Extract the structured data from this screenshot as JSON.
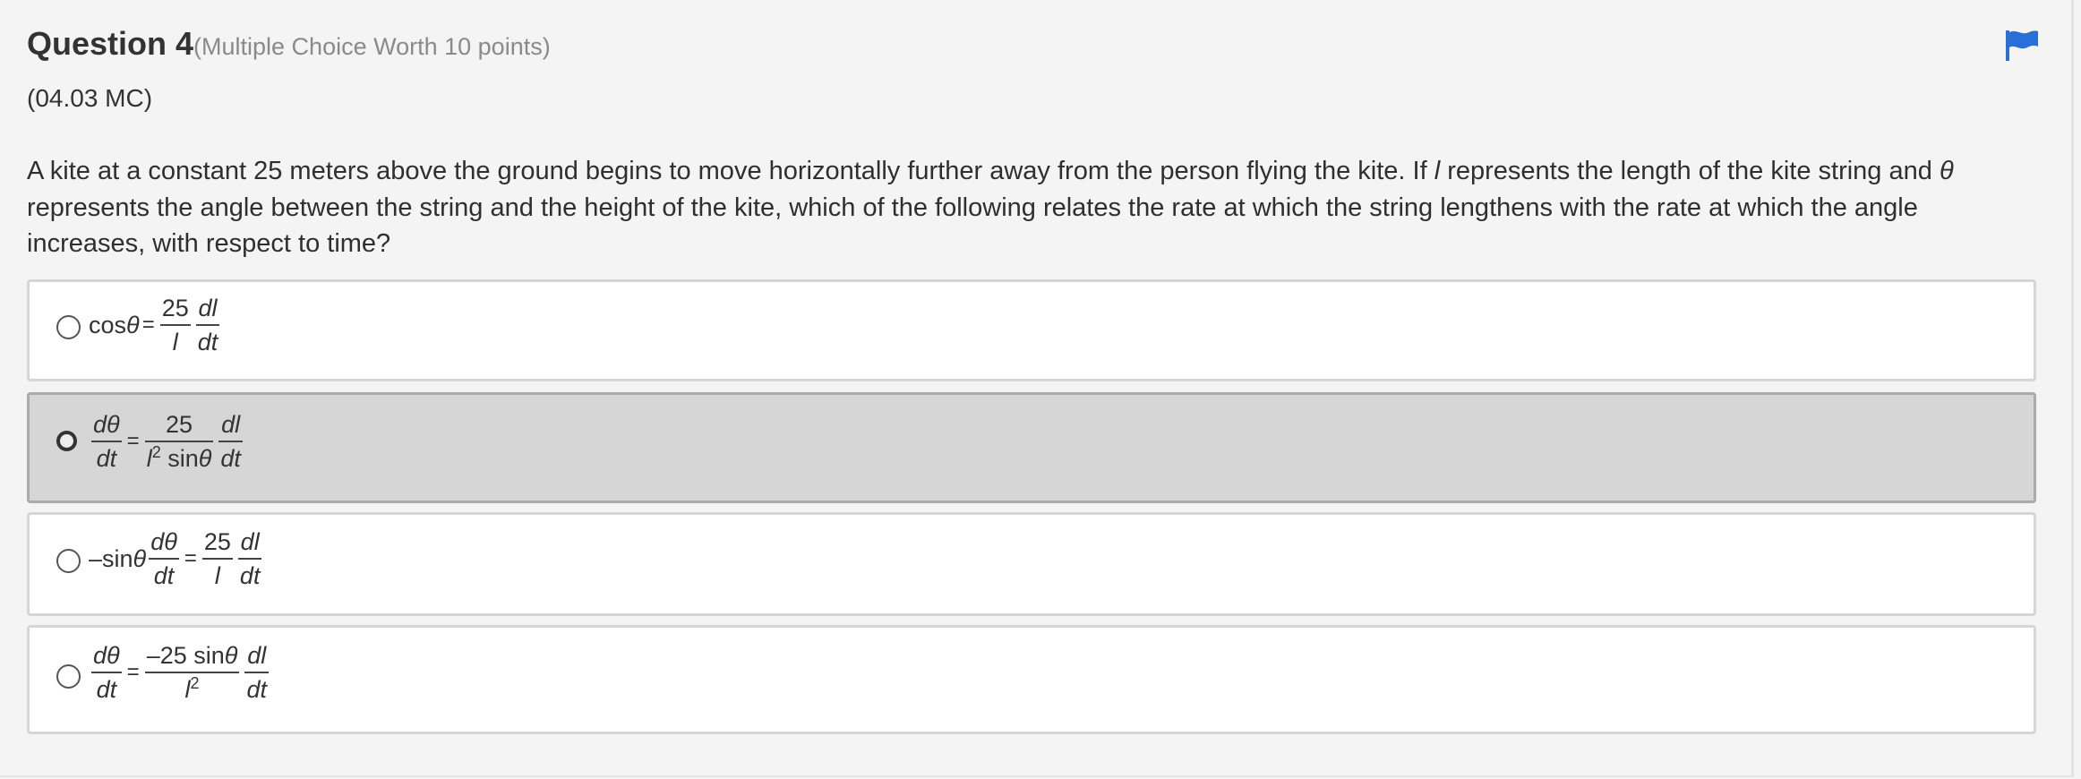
{
  "question": {
    "title": "Question 4",
    "points": "(Multiple Choice Worth 10 points)",
    "code": "(04.03 MC)",
    "stem_part1": "A kite at a constant 25 meters above the ground begins to move horizontally further away from the person flying the kite. If ",
    "stem_var_l": "l",
    "stem_part2": " represents the length of the kite string and ",
    "stem_var_theta": "θ",
    "stem_part3": " represents the angle between the string and the height of the kite, which of the following relates the rate at which the string lengthens with the rate at which the angle increases, with respect to time?",
    "flag_icon": "flag-icon",
    "flag_color": "#2a6ed8"
  },
  "choices": [
    {
      "selected": false,
      "parts": {
        "lhs": "cos",
        "theta": "θ",
        "eq": "=",
        "f1_num": "25",
        "f1_den": "l",
        "f2_num": "dl",
        "f2_den": "dt"
      }
    },
    {
      "selected": true,
      "parts": {
        "f1_num": "dθ",
        "f1_den": "dt",
        "eq": "=",
        "f2_num": "25",
        "f2_den_a": "l",
        "f2_den_sup": "2",
        "f2_den_b": "sin",
        "f2_den_theta": "θ",
        "f3_num": "dl",
        "f3_den": "dt"
      }
    },
    {
      "selected": false,
      "parts": {
        "lhs": "–sin",
        "theta": "θ",
        "f1_num": "dθ",
        "f1_den": "dt",
        "eq": "=",
        "f2_num": "25",
        "f2_den": "l",
        "f3_num": "dl",
        "f3_den": "dt"
      }
    },
    {
      "selected": false,
      "parts": {
        "f1_num": "dθ",
        "f1_den": "dt",
        "eq": "=",
        "f2_num_a": "–25",
        "f2_num_b": "sin",
        "f2_num_theta": "θ",
        "f2_den_a": "l",
        "f2_den_sup": "2",
        "f3_num": "dl",
        "f3_den": "dt"
      }
    }
  ]
}
